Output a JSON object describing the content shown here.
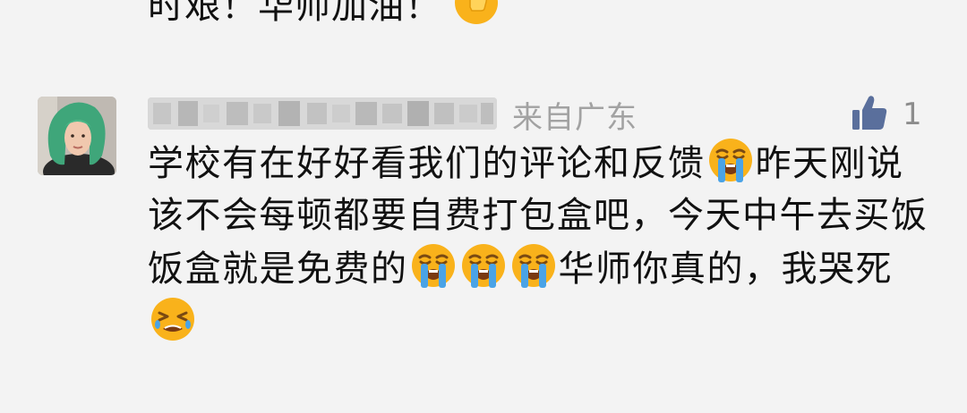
{
  "previous_comment": {
    "text": "时艰！华师加油！",
    "emoji": "thumbs-up"
  },
  "comment": {
    "location": "来自广东",
    "like_count": "1",
    "segments": [
      {
        "type": "text",
        "value": "学校有在好好看我们的评论和反馈"
      },
      {
        "type": "emoji",
        "value": "loudly-crying-face"
      },
      {
        "type": "text",
        "value": "昨天刚说该不会每顿都要自费打包盒吧，今天中午去买饭饭盒就是免费的"
      },
      {
        "type": "emoji",
        "value": "loudly-crying-face"
      },
      {
        "type": "emoji",
        "value": "loudly-crying-face"
      },
      {
        "type": "emoji",
        "value": "loudly-crying-face"
      },
      {
        "type": "text",
        "value": "华师你真的，我哭死"
      },
      {
        "type": "emoji",
        "value": "tired-face"
      }
    ]
  },
  "colors": {
    "background": "#f3f3f3",
    "text": "#111111",
    "meta": "#a2a2a2",
    "like_icon": "#5a6f9c",
    "emoji_yellow": "#f9b21b",
    "emoji_tear": "#4aa3e6"
  },
  "icons": {
    "like": "thumbs-up-icon"
  }
}
